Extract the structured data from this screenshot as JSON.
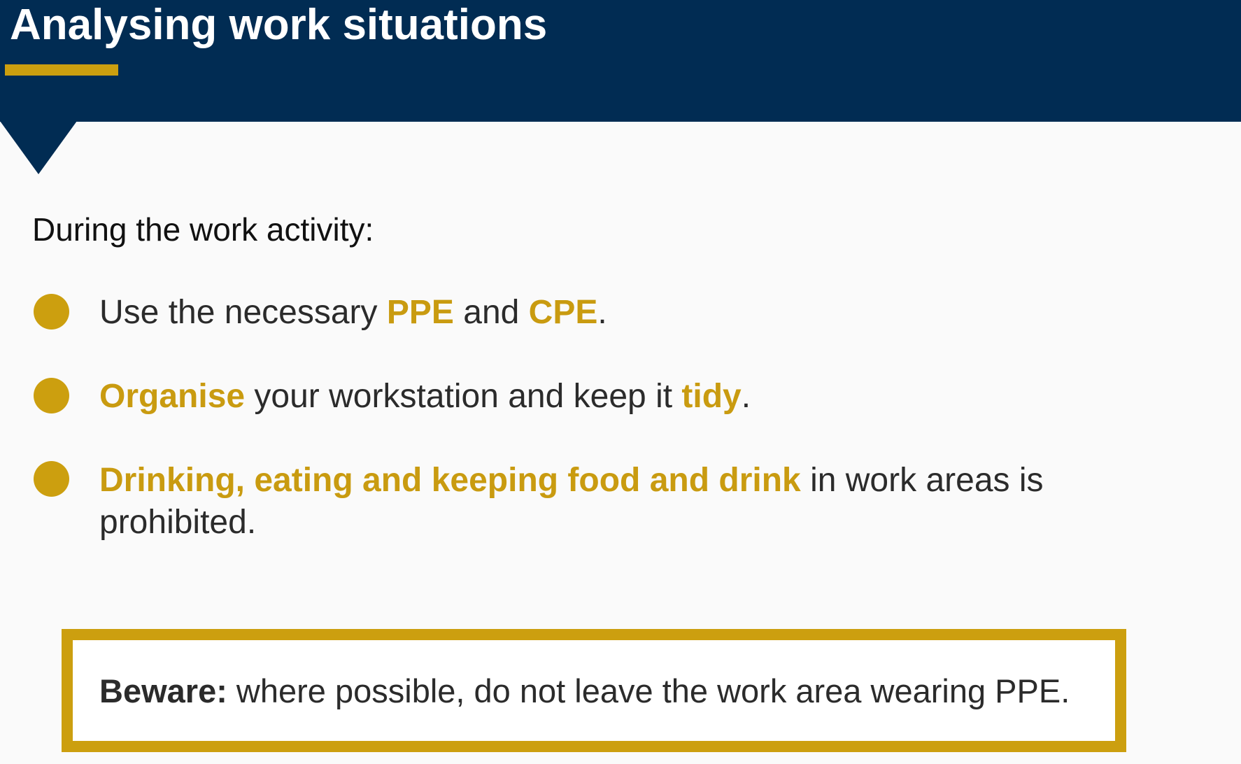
{
  "header": {
    "title": "Analysing work situations"
  },
  "colors": {
    "navy": "#012c53",
    "gold": "#cc9f0f",
    "background": "#fafafa"
  },
  "content": {
    "intro": "During the work activity:",
    "bullets": [
      {
        "parts": [
          {
            "text": "Use the necessary ",
            "highlight": false
          },
          {
            "text": "PPE",
            "highlight": true
          },
          {
            "text": " and ",
            "highlight": false
          },
          {
            "text": "CPE",
            "highlight": true
          },
          {
            "text": ".",
            "highlight": false
          }
        ]
      },
      {
        "parts": [
          {
            "text": "Organise",
            "highlight": true
          },
          {
            "text": " your workstation and keep it ",
            "highlight": false
          },
          {
            "text": "tidy",
            "highlight": true
          },
          {
            "text": ".",
            "highlight": false
          }
        ]
      },
      {
        "parts": [
          {
            "text": "Drinking, eating and keeping food and drink",
            "highlight": true
          },
          {
            "text": " in work areas is prohibited.",
            "highlight": false
          }
        ]
      }
    ]
  },
  "beware": {
    "label": "Beware:",
    "text": " where possible, do not leave the work area wearing PPE."
  }
}
